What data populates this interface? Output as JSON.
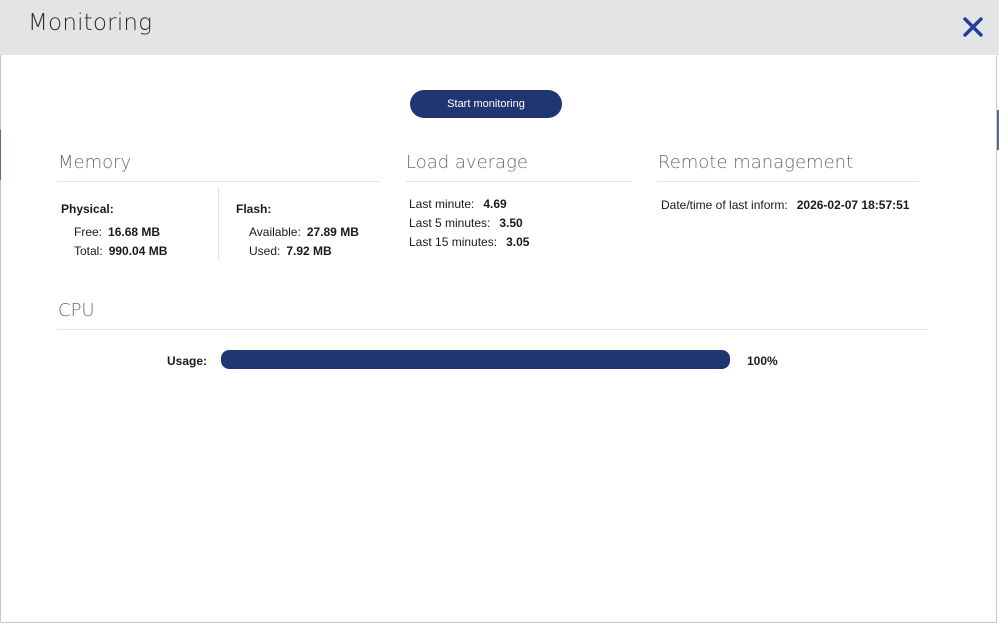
{
  "header": {
    "title": "Monitoring",
    "close_icon": "close-icon"
  },
  "actions": {
    "start_label": "Start monitoring"
  },
  "memory": {
    "title": "Memory",
    "physical": {
      "heading": "Physical:",
      "free_label": "Free:",
      "free_value": "16.68 MB",
      "total_label": "Total:",
      "total_value": "990.04 MB"
    },
    "flash": {
      "heading": "Flash:",
      "available_label": "Available:",
      "available_value": "27.89 MB",
      "used_label": "Used:",
      "used_value": "7.92 MB"
    }
  },
  "load_average": {
    "title": "Load average",
    "rows": [
      {
        "label": "Last minute:",
        "value": "4.69"
      },
      {
        "label": "Last 5 minutes:",
        "value": "3.50"
      },
      {
        "label": "Last 15 minutes:",
        "value": "3.05"
      }
    ]
  },
  "remote_management": {
    "title": "Remote management",
    "last_inform_label": "Date/time of last inform:",
    "last_inform_value": "2026-02-07 18:57:51"
  },
  "cpu": {
    "title": "CPU",
    "usage_label": "Usage:",
    "usage_text": "100%",
    "usage_fraction": 1.0
  },
  "colors": {
    "accent": "#1f3672",
    "header_bg": "#e3e4e5"
  }
}
